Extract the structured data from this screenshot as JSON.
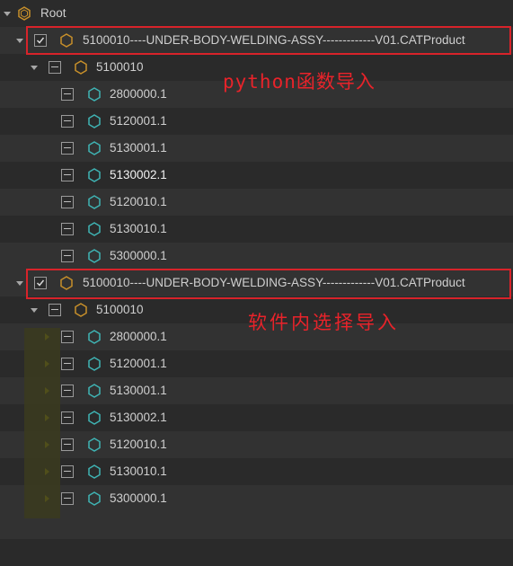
{
  "root": {
    "label": "Root"
  },
  "product_a": {
    "label": "5100010----UNDER-BODY-WELDING-ASSY-------------V01.CATProduct",
    "sub": "5100010",
    "parts": [
      "2800000.1",
      "5120001.1",
      "5130001.1",
      "5130002.1",
      "5120010.1",
      "5130010.1",
      "5300000.1"
    ],
    "highlighted_part_index": 3
  },
  "product_b": {
    "label": "5100010----UNDER-BODY-WELDING-ASSY-------------V01.CATProduct",
    "sub": "5100010",
    "parts": [
      "2800000.1",
      "5120001.1",
      "5130001.1",
      "5130002.1",
      "5120010.1",
      "5130010.1",
      "5300000.1"
    ]
  },
  "annotations": {
    "python_import": "python函数导入",
    "software_import": "软件内选择导入"
  },
  "colors": {
    "background": "#2b2b2b",
    "highlight_border": "#d8232a",
    "annotation_text": "#e8232a",
    "assembly_icon": "#c8902a",
    "part_icon": "#3fb4b4",
    "expand_arrow_yellow": "#c9c200"
  },
  "icons": {
    "root": "root-assembly-icon",
    "product": "product-hexagon-icon",
    "part": "part-hexagon-icon"
  }
}
